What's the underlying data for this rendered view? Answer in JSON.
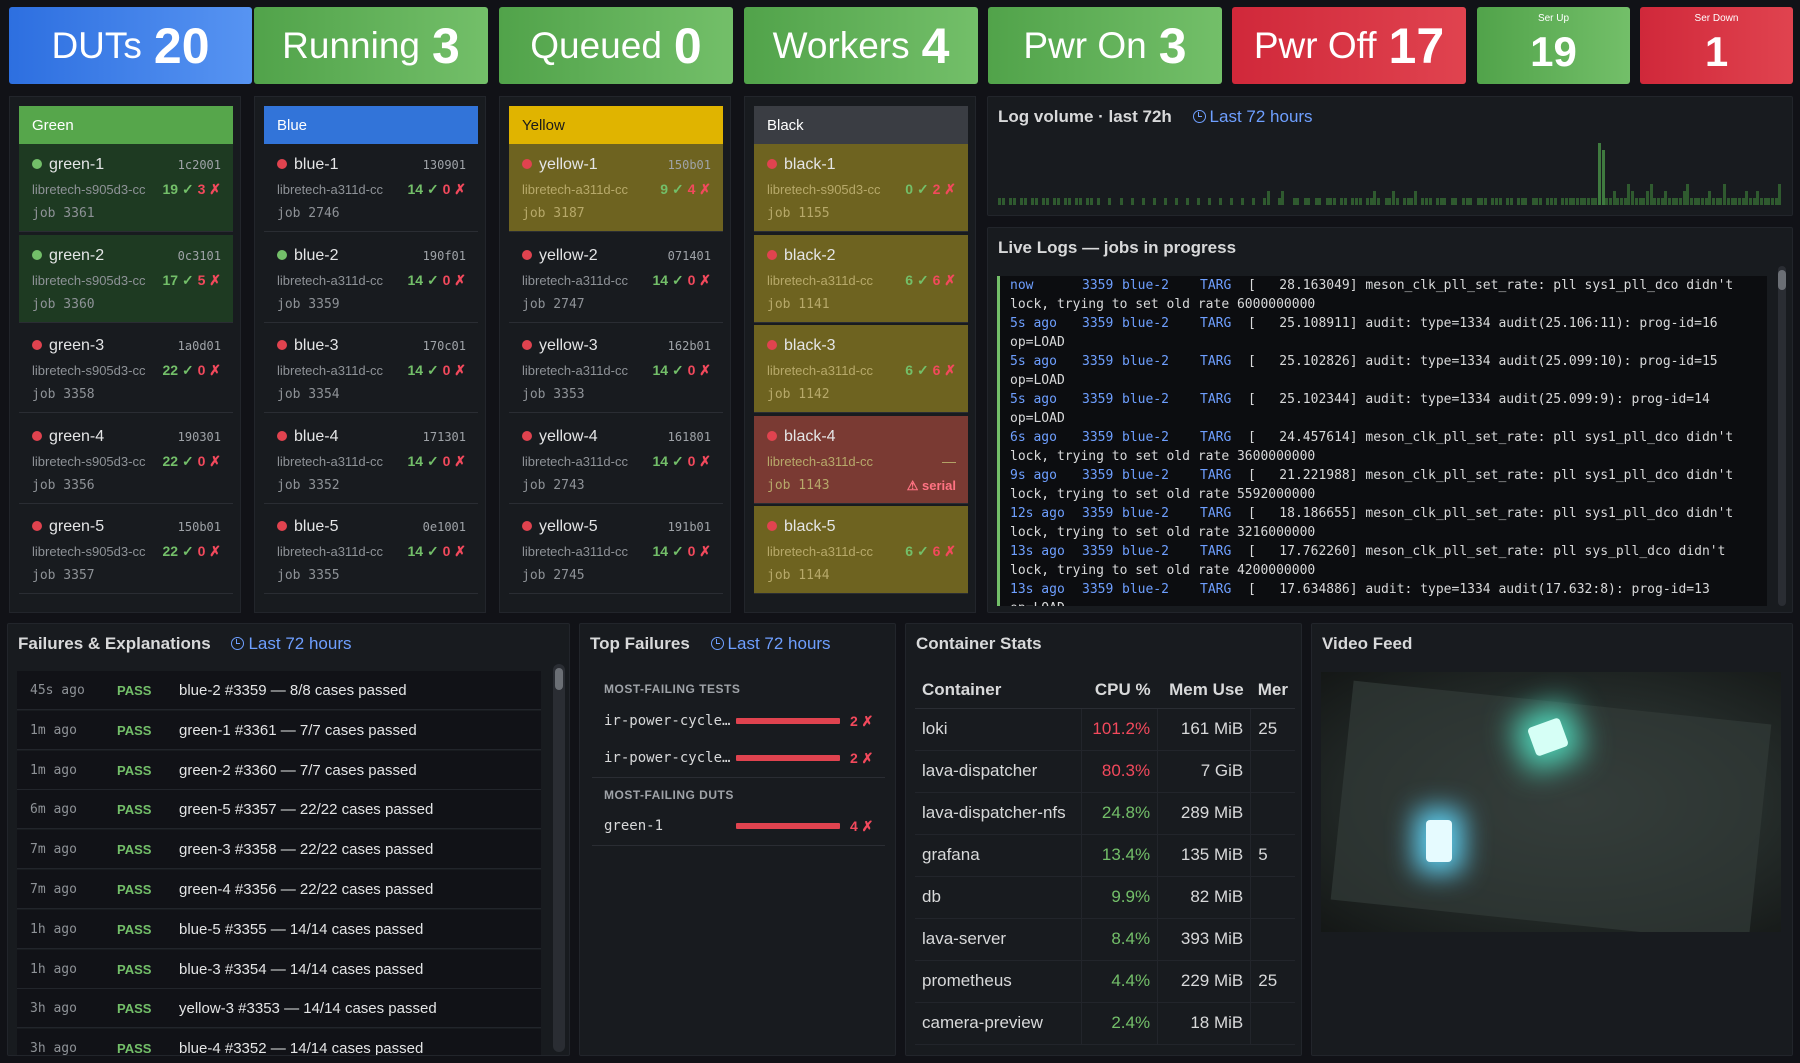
{
  "stats": [
    {
      "label": "DUTs",
      "value": "20",
      "color": "#5794f2"
    },
    {
      "label": "Running",
      "value": "3",
      "color": "#73bf69"
    },
    {
      "label": "Queued",
      "value": "0",
      "color": "#73bf69"
    },
    {
      "label": "Workers",
      "value": "4",
      "color": "#73bf69"
    },
    {
      "label": "Pwr On",
      "value": "3",
      "color": "#73bf69"
    },
    {
      "label": "Pwr Off",
      "value": "17",
      "color": "#e0434f"
    },
    {
      "label": "Ser Up",
      "value": "19",
      "color": "#73bf69"
    },
    {
      "label": "Ser Down",
      "value": "1",
      "color": "#e0434f"
    }
  ],
  "groups": [
    {
      "name": "Green",
      "color": "#56a64b",
      "duts": [
        {
          "name": "green-1",
          "serial": "1c2001",
          "platform": "libretech-s905d3-cc",
          "pass": "19 ✓",
          "fail": "3 ✗",
          "job": "job 3361",
          "status": "#73bf69",
          "state": "running"
        },
        {
          "name": "green-2",
          "serial": "0c3101",
          "platform": "libretech-s905d3-cc",
          "pass": "17 ✓",
          "fail": "5 ✗",
          "job": "job 3360",
          "status": "#73bf69",
          "state": "running"
        },
        {
          "name": "green-3",
          "serial": "1a0d01",
          "platform": "libretech-s905d3-cc",
          "pass": "22 ✓",
          "fail": "0 ✗",
          "job": "job 3358",
          "status": "#e0434f",
          "state": "idle"
        },
        {
          "name": "green-4",
          "serial": "190301",
          "platform": "libretech-s905d3-cc",
          "pass": "22 ✓",
          "fail": "0 ✗",
          "job": "job 3356",
          "status": "#e0434f",
          "state": "idle"
        },
        {
          "name": "green-5",
          "serial": "150b01",
          "platform": "libretech-s905d3-cc",
          "pass": "22 ✓",
          "fail": "0 ✗",
          "job": "job 3357",
          "status": "#e0434f",
          "state": "idle"
        }
      ]
    },
    {
      "name": "Blue",
      "color": "#3274d9",
      "duts": [
        {
          "name": "blue-1",
          "serial": "130901",
          "platform": "libretech-a311d-cc",
          "pass": "14 ✓",
          "fail": "0 ✗",
          "job": "job 2746",
          "status": "#e0434f",
          "state": "idle"
        },
        {
          "name": "blue-2",
          "serial": "190f01",
          "platform": "libretech-a311d-cc",
          "pass": "14 ✓",
          "fail": "0 ✗",
          "job": "job 3359",
          "status": "#73bf69",
          "state": "active"
        },
        {
          "name": "blue-3",
          "serial": "170c01",
          "platform": "libretech-a311d-cc",
          "pass": "14 ✓",
          "fail": "0 ✗",
          "job": "job 3354",
          "status": "#e0434f",
          "state": "idle"
        },
        {
          "name": "blue-4",
          "serial": "171301",
          "platform": "libretech-a311d-cc",
          "pass": "14 ✓",
          "fail": "0 ✗",
          "job": "job 3352",
          "status": "#e0434f",
          "state": "idle"
        },
        {
          "name": "blue-5",
          "serial": "0e1001",
          "platform": "libretech-a311d-cc",
          "pass": "14 ✓",
          "fail": "0 ✗",
          "job": "job 3355",
          "status": "#e0434f",
          "state": "idle"
        }
      ]
    },
    {
      "name": "Yellow",
      "color": "#e0b400",
      "duts": [
        {
          "name": "yellow-1",
          "serial": "150b01",
          "platform": "libretech-a311d-cc",
          "pass": "9 ✓",
          "fail": "4 ✗",
          "job": "job 3187",
          "status": "#e0434f",
          "state": "warn"
        },
        {
          "name": "yellow-2",
          "serial": "071401",
          "platform": "libretech-a311d-cc",
          "pass": "14 ✓",
          "fail": "0 ✗",
          "job": "job 2747",
          "status": "#e0434f",
          "state": "idle"
        },
        {
          "name": "yellow-3",
          "serial": "162b01",
          "platform": "libretech-a311d-cc",
          "pass": "14 ✓",
          "fail": "0 ✗",
          "job": "job 3353",
          "status": "#e0434f",
          "state": "idle"
        },
        {
          "name": "yellow-4",
          "serial": "161801",
          "platform": "libretech-a311d-cc",
          "pass": "14 ✓",
          "fail": "0 ✗",
          "job": "job 2743",
          "status": "#e0434f",
          "state": "idle"
        },
        {
          "name": "yellow-5",
          "serial": "191b01",
          "platform": "libretech-a311d-cc",
          "pass": "14 ✓",
          "fail": "0 ✗",
          "job": "job 2745",
          "status": "#e0434f",
          "state": "idle"
        }
      ]
    },
    {
      "name": "Black",
      "color": "#3a3d43",
      "duts": [
        {
          "name": "black-1",
          "serial": "",
          "platform": "libretech-s905d3-cc",
          "pass": "0 ✓",
          "fail": "2 ✗",
          "job": "job 1155",
          "status": "#e0434f",
          "state": "warn"
        },
        {
          "name": "black-2",
          "serial": "",
          "platform": "libretech-a311d-cc",
          "pass": "6 ✓",
          "fail": "6 ✗",
          "job": "job 1141",
          "status": "#e0434f",
          "state": "warn"
        },
        {
          "name": "black-3",
          "serial": "",
          "platform": "libretech-a311d-cc",
          "pass": "6 ✓",
          "fail": "6 ✗",
          "job": "job 1142",
          "status": "#e0434f",
          "state": "warn"
        },
        {
          "name": "black-4",
          "serial": "",
          "platform": "libretech-a311d-cc",
          "pass": "—",
          "fail": "",
          "job": "job 1143",
          "status": "#e0434f",
          "state": "error",
          "alert": "⚠ serial"
        },
        {
          "name": "black-5",
          "serial": "",
          "platform": "libretech-a311d-cc",
          "pass": "6 ✓",
          "fail": "6 ✗",
          "job": "job 1144",
          "status": "#e0434f",
          "state": "warn"
        }
      ]
    }
  ],
  "log_volume": {
    "title": "Log volume · last 72h",
    "range": "Last 72 hours",
    "bars": [
      1,
      1,
      0,
      1,
      1,
      0,
      1,
      1,
      0,
      1,
      1,
      0,
      1,
      1,
      0,
      1,
      1,
      0,
      1,
      1,
      0,
      1,
      1,
      0,
      1,
      1,
      0,
      1,
      0,
      0,
      1,
      0,
      0,
      1,
      0,
      0,
      1,
      0,
      0,
      1,
      0,
      0,
      1,
      0,
      0,
      1,
      0,
      0,
      1,
      0,
      0,
      1,
      0,
      0,
      1,
      0,
      0,
      1,
      0,
      0,
      1,
      0,
      0,
      1,
      0,
      0,
      1,
      0,
      0,
      1,
      0,
      0,
      1,
      2,
      0,
      0,
      1,
      2,
      0,
      0,
      1,
      1,
      0,
      1,
      1,
      0,
      1,
      1,
      0,
      1,
      1,
      1,
      0,
      1,
      1,
      0,
      1,
      1,
      1,
      0,
      1,
      1,
      2,
      1,
      0,
      1,
      1,
      2,
      1,
      0,
      1,
      1,
      1,
      2,
      0,
      1,
      1,
      1,
      0,
      1,
      1,
      1,
      0,
      1,
      1,
      0,
      1,
      1,
      1,
      0,
      1,
      1,
      1,
      0,
      1,
      1,
      1,
      0,
      1,
      1,
      0,
      1,
      1,
      1,
      0,
      1,
      1,
      1,
      0,
      1,
      1,
      1,
      0,
      1,
      1,
      1,
      1,
      1,
      1,
      1,
      1,
      1,
      1,
      9,
      8,
      1,
      1,
      2,
      1,
      1,
      1,
      3,
      2,
      1,
      1,
      1,
      2,
      3,
      1,
      1,
      1,
      2,
      1,
      1,
      1,
      1,
      2,
      3,
      1,
      1,
      1,
      1,
      1,
      2,
      1,
      1,
      1,
      3,
      1,
      1,
      1,
      1,
      1,
      2,
      1,
      1,
      2,
      1,
      1,
      1,
      1,
      1,
      3
    ]
  },
  "live_logs": {
    "title": "Live Logs — jobs in progress",
    "lines": [
      {
        "t": "now",
        "job": "3359",
        "dut": "blue-2",
        "tag": "TARG",
        "msg": "[   28.163049] meson_clk_pll_set_rate: pll sys1_pll_dco didn't"
      },
      {
        "t": "",
        "job": "",
        "dut": "",
        "tag": "",
        "msg": "lock, trying to set old rate 6000000000"
      },
      {
        "t": "5s ago",
        "job": "3359",
        "dut": "blue-2",
        "tag": "TARG",
        "msg": "[   25.108911] audit: type=1334 audit(25.106:11): prog-id=16"
      },
      {
        "t": "",
        "job": "",
        "dut": "",
        "tag": "",
        "msg": "op=LOAD"
      },
      {
        "t": "5s ago",
        "job": "3359",
        "dut": "blue-2",
        "tag": "TARG",
        "msg": "[   25.102826] audit: type=1334 audit(25.099:10): prog-id=15"
      },
      {
        "t": "",
        "job": "",
        "dut": "",
        "tag": "",
        "msg": "op=LOAD"
      },
      {
        "t": "5s ago",
        "job": "3359",
        "dut": "blue-2",
        "tag": "TARG",
        "msg": "[   25.102344] audit: type=1334 audit(25.099:9): prog-id=14"
      },
      {
        "t": "",
        "job": "",
        "dut": "",
        "tag": "",
        "msg": "op=LOAD"
      },
      {
        "t": "6s ago",
        "job": "3359",
        "dut": "blue-2",
        "tag": "TARG",
        "msg": "[   24.457614] meson_clk_pll_set_rate: pll sys1_pll_dco didn't"
      },
      {
        "t": "",
        "job": "",
        "dut": "",
        "tag": "",
        "msg": "lock, trying to set old rate 3600000000"
      },
      {
        "t": "9s ago",
        "job": "3359",
        "dut": "blue-2",
        "tag": "TARG",
        "msg": "[   21.221988] meson_clk_pll_set_rate: pll sys1_pll_dco didn't"
      },
      {
        "t": "",
        "job": "",
        "dut": "",
        "tag": "",
        "msg": "lock, trying to set old rate 5592000000"
      },
      {
        "t": "12s ago",
        "job": "3359",
        "dut": "blue-2",
        "tag": "TARG",
        "msg": "[   18.186655] meson_clk_pll_set_rate: pll sys1_pll_dco didn't"
      },
      {
        "t": "",
        "job": "",
        "dut": "",
        "tag": "",
        "msg": "lock, trying to set old rate 3216000000"
      },
      {
        "t": "13s ago",
        "job": "3359",
        "dut": "blue-2",
        "tag": "TARG",
        "msg": "[   17.762260] meson_clk_pll_set_rate: pll sys_pll_dco didn't"
      },
      {
        "t": "",
        "job": "",
        "dut": "",
        "tag": "",
        "msg": "lock, trying to set old rate 4200000000"
      },
      {
        "t": "13s ago",
        "job": "3359",
        "dut": "blue-2",
        "tag": "TARG",
        "msg": "[   17.634886] audit: type=1334 audit(17.632:8): prog-id=13"
      },
      {
        "t": "",
        "job": "",
        "dut": "",
        "tag": "",
        "msg": "op=LOAD"
      }
    ]
  },
  "failures": {
    "title": "Failures & Explanations",
    "range": "Last 72 hours",
    "rows": [
      {
        "time": "45s ago",
        "status": "PASS",
        "msg": "blue-2 #3359 — 8/8 cases passed"
      },
      {
        "time": "1m ago",
        "status": "PASS",
        "msg": "green-1 #3361 — 7/7 cases passed"
      },
      {
        "time": "1m ago",
        "status": "PASS",
        "msg": "green-2 #3360 — 7/7 cases passed"
      },
      {
        "time": "6m ago",
        "status": "PASS",
        "msg": "green-5 #3357 — 22/22 cases passed"
      },
      {
        "time": "7m ago",
        "status": "PASS",
        "msg": "green-3 #3358 — 22/22 cases passed"
      },
      {
        "time": "7m ago",
        "status": "PASS",
        "msg": "green-4 #3356 — 22/22 cases passed"
      },
      {
        "time": "1h ago",
        "status": "PASS",
        "msg": "blue-5 #3355 — 14/14 cases passed"
      },
      {
        "time": "1h ago",
        "status": "PASS",
        "msg": "blue-3 #3354 — 14/14 cases passed"
      },
      {
        "time": "3h ago",
        "status": "PASS",
        "msg": "yellow-3 #3353 — 14/14 cases passed"
      },
      {
        "time": "3h ago",
        "status": "PASS",
        "msg": "blue-4 #3352 — 14/14 cases passed"
      }
    ]
  },
  "top_failures": {
    "title": "Top Failures",
    "range": "Last 72 hours",
    "tests_label": "MOST-FAILING TESTS",
    "tests": [
      {
        "name": "ir-power-cycle…",
        "count": "2 ✗"
      },
      {
        "name": "ir-power-cycle…",
        "count": "2 ✗"
      }
    ],
    "duts_label": "MOST-FAILING DUTS",
    "duts": [
      {
        "name": "green-1",
        "count": "4 ✗"
      }
    ]
  },
  "container_stats": {
    "title": "Container Stats",
    "headers": [
      "Container",
      "CPU %",
      "Mem Use",
      "Mer"
    ],
    "rows": [
      {
        "name": "loki",
        "cpu": "101.2%",
        "cpu_color": "#f2495c",
        "mem": "161 MiB",
        "extra": "25"
      },
      {
        "name": "lava-dispatcher",
        "cpu": "80.3%",
        "cpu_color": "#f2495c",
        "mem": "7 GiB",
        "extra": ""
      },
      {
        "name": "lava-dispatcher-nfs",
        "cpu": "24.8%",
        "cpu_color": "#73bf69",
        "mem": "289 MiB",
        "extra": ""
      },
      {
        "name": "grafana",
        "cpu": "13.4%",
        "cpu_color": "#73bf69",
        "mem": "135 MiB",
        "extra": "5"
      },
      {
        "name": "db",
        "cpu": "9.9%",
        "cpu_color": "#73bf69",
        "mem": "82 MiB",
        "extra": ""
      },
      {
        "name": "lava-server",
        "cpu": "8.4%",
        "cpu_color": "#73bf69",
        "mem": "393 MiB",
        "extra": ""
      },
      {
        "name": "prometheus",
        "cpu": "4.4%",
        "cpu_color": "#73bf69",
        "mem": "229 MiB",
        "extra": "25"
      },
      {
        "name": "camera-preview",
        "cpu": "2.4%",
        "cpu_color": "#73bf69",
        "mem": "18 MiB",
        "extra": ""
      }
    ]
  },
  "video_feed": {
    "title": "Video Feed"
  }
}
